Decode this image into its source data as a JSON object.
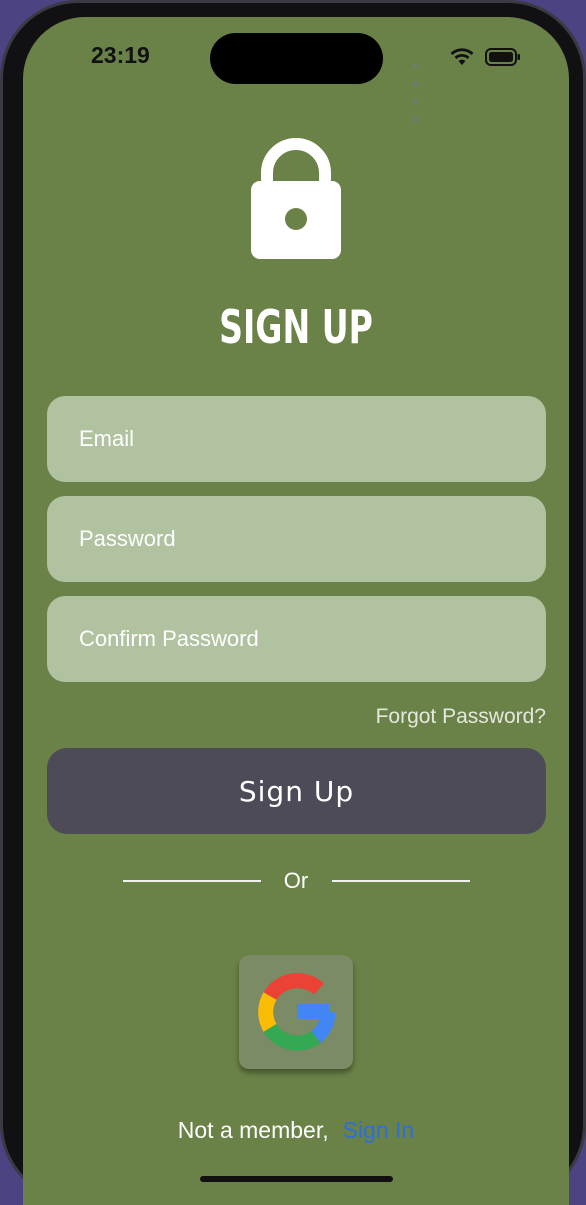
{
  "status_bar": {
    "time": "23:19"
  },
  "header": {
    "title": "SIGN UP",
    "icon": "lock-icon"
  },
  "form": {
    "email_placeholder": "Email",
    "password_placeholder": "Password",
    "confirm_placeholder": "Confirm Password",
    "forgot_label": "Forgot Password?",
    "submit_label": "Sign Up"
  },
  "divider": {
    "label": "Or"
  },
  "social": {
    "google_icon": "google-icon"
  },
  "footer": {
    "prompt": "Not a member,",
    "link_label": "Sign In"
  },
  "colors": {
    "background": "#6a8247",
    "field": "#b0c2a0",
    "button": "#4e4b58",
    "link": "#2a6fdd"
  }
}
